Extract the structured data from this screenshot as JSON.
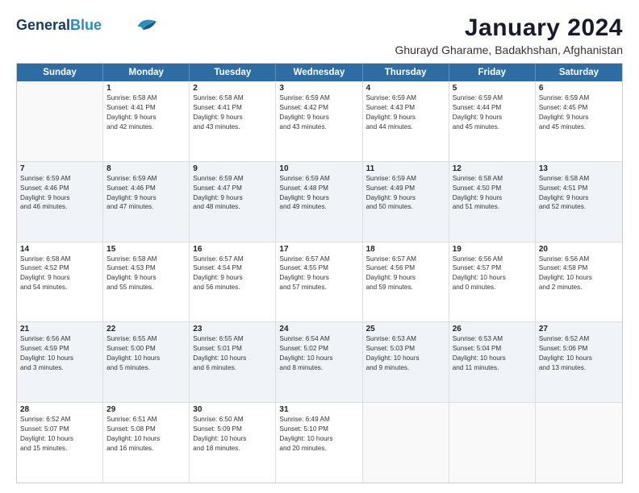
{
  "logo": {
    "line1": "General",
    "line2": "Blue"
  },
  "title": "January 2024",
  "subtitle": "Ghurayd Gharame, Badakhshan, Afghanistan",
  "header_days": [
    "Sunday",
    "Monday",
    "Tuesday",
    "Wednesday",
    "Thursday",
    "Friday",
    "Saturday"
  ],
  "weeks": [
    [
      {
        "day": "",
        "lines": [],
        "shaded": false
      },
      {
        "day": "1",
        "lines": [
          "Sunrise: 6:58 AM",
          "Sunset: 4:41 PM",
          "Daylight: 9 hours",
          "and 42 minutes."
        ],
        "shaded": false
      },
      {
        "day": "2",
        "lines": [
          "Sunrise: 6:58 AM",
          "Sunset: 4:41 PM",
          "Daylight: 9 hours",
          "and 43 minutes."
        ],
        "shaded": false
      },
      {
        "day": "3",
        "lines": [
          "Sunrise: 6:59 AM",
          "Sunset: 4:42 PM",
          "Daylight: 9 hours",
          "and 43 minutes."
        ],
        "shaded": false
      },
      {
        "day": "4",
        "lines": [
          "Sunrise: 6:59 AM",
          "Sunset: 4:43 PM",
          "Daylight: 9 hours",
          "and 44 minutes."
        ],
        "shaded": false
      },
      {
        "day": "5",
        "lines": [
          "Sunrise: 6:59 AM",
          "Sunset: 4:44 PM",
          "Daylight: 9 hours",
          "and 45 minutes."
        ],
        "shaded": false
      },
      {
        "day": "6",
        "lines": [
          "Sunrise: 6:59 AM",
          "Sunset: 4:45 PM",
          "Daylight: 9 hours",
          "and 45 minutes."
        ],
        "shaded": false
      }
    ],
    [
      {
        "day": "7",
        "lines": [
          "Sunrise: 6:59 AM",
          "Sunset: 4:46 PM",
          "Daylight: 9 hours",
          "and 46 minutes."
        ],
        "shaded": true
      },
      {
        "day": "8",
        "lines": [
          "Sunrise: 6:59 AM",
          "Sunset: 4:46 PM",
          "Daylight: 9 hours",
          "and 47 minutes."
        ],
        "shaded": true
      },
      {
        "day": "9",
        "lines": [
          "Sunrise: 6:59 AM",
          "Sunset: 4:47 PM",
          "Daylight: 9 hours",
          "and 48 minutes."
        ],
        "shaded": true
      },
      {
        "day": "10",
        "lines": [
          "Sunrise: 6:59 AM",
          "Sunset: 4:48 PM",
          "Daylight: 9 hours",
          "and 49 minutes."
        ],
        "shaded": true
      },
      {
        "day": "11",
        "lines": [
          "Sunrise: 6:59 AM",
          "Sunset: 4:49 PM",
          "Daylight: 9 hours",
          "and 50 minutes."
        ],
        "shaded": true
      },
      {
        "day": "12",
        "lines": [
          "Sunrise: 6:58 AM",
          "Sunset: 4:50 PM",
          "Daylight: 9 hours",
          "and 51 minutes."
        ],
        "shaded": true
      },
      {
        "day": "13",
        "lines": [
          "Sunrise: 6:58 AM",
          "Sunset: 4:51 PM",
          "Daylight: 9 hours",
          "and 52 minutes."
        ],
        "shaded": true
      }
    ],
    [
      {
        "day": "14",
        "lines": [
          "Sunrise: 6:58 AM",
          "Sunset: 4:52 PM",
          "Daylight: 9 hours",
          "and 54 minutes."
        ],
        "shaded": false
      },
      {
        "day": "15",
        "lines": [
          "Sunrise: 6:58 AM",
          "Sunset: 4:53 PM",
          "Daylight: 9 hours",
          "and 55 minutes."
        ],
        "shaded": false
      },
      {
        "day": "16",
        "lines": [
          "Sunrise: 6:57 AM",
          "Sunset: 4:54 PM",
          "Daylight: 9 hours",
          "and 56 minutes."
        ],
        "shaded": false
      },
      {
        "day": "17",
        "lines": [
          "Sunrise: 6:57 AM",
          "Sunset: 4:55 PM",
          "Daylight: 9 hours",
          "and 57 minutes."
        ],
        "shaded": false
      },
      {
        "day": "18",
        "lines": [
          "Sunrise: 6:57 AM",
          "Sunset: 4:56 PM",
          "Daylight: 9 hours",
          "and 59 minutes."
        ],
        "shaded": false
      },
      {
        "day": "19",
        "lines": [
          "Sunrise: 6:56 AM",
          "Sunset: 4:57 PM",
          "Daylight: 10 hours",
          "and 0 minutes."
        ],
        "shaded": false
      },
      {
        "day": "20",
        "lines": [
          "Sunrise: 6:56 AM",
          "Sunset: 4:58 PM",
          "Daylight: 10 hours",
          "and 2 minutes."
        ],
        "shaded": false
      }
    ],
    [
      {
        "day": "21",
        "lines": [
          "Sunrise: 6:56 AM",
          "Sunset: 4:59 PM",
          "Daylight: 10 hours",
          "and 3 minutes."
        ],
        "shaded": true
      },
      {
        "day": "22",
        "lines": [
          "Sunrise: 6:55 AM",
          "Sunset: 5:00 PM",
          "Daylight: 10 hours",
          "and 5 minutes."
        ],
        "shaded": true
      },
      {
        "day": "23",
        "lines": [
          "Sunrise: 6:55 AM",
          "Sunset: 5:01 PM",
          "Daylight: 10 hours",
          "and 6 minutes."
        ],
        "shaded": true
      },
      {
        "day": "24",
        "lines": [
          "Sunrise: 6:54 AM",
          "Sunset: 5:02 PM",
          "Daylight: 10 hours",
          "and 8 minutes."
        ],
        "shaded": true
      },
      {
        "day": "25",
        "lines": [
          "Sunrise: 6:53 AM",
          "Sunset: 5:03 PM",
          "Daylight: 10 hours",
          "and 9 minutes."
        ],
        "shaded": true
      },
      {
        "day": "26",
        "lines": [
          "Sunrise: 6:53 AM",
          "Sunset: 5:04 PM",
          "Daylight: 10 hours",
          "and 11 minutes."
        ],
        "shaded": true
      },
      {
        "day": "27",
        "lines": [
          "Sunrise: 6:52 AM",
          "Sunset: 5:06 PM",
          "Daylight: 10 hours",
          "and 13 minutes."
        ],
        "shaded": true
      }
    ],
    [
      {
        "day": "28",
        "lines": [
          "Sunrise: 6:52 AM",
          "Sunset: 5:07 PM",
          "Daylight: 10 hours",
          "and 15 minutes."
        ],
        "shaded": false
      },
      {
        "day": "29",
        "lines": [
          "Sunrise: 6:51 AM",
          "Sunset: 5:08 PM",
          "Daylight: 10 hours",
          "and 16 minutes."
        ],
        "shaded": false
      },
      {
        "day": "30",
        "lines": [
          "Sunrise: 6:50 AM",
          "Sunset: 5:09 PM",
          "Daylight: 10 hours",
          "and 18 minutes."
        ],
        "shaded": false
      },
      {
        "day": "31",
        "lines": [
          "Sunrise: 6:49 AM",
          "Sunset: 5:10 PM",
          "Daylight: 10 hours",
          "and 20 minutes."
        ],
        "shaded": false
      },
      {
        "day": "",
        "lines": [],
        "shaded": false
      },
      {
        "day": "",
        "lines": [],
        "shaded": false
      },
      {
        "day": "",
        "lines": [],
        "shaded": false
      }
    ]
  ]
}
